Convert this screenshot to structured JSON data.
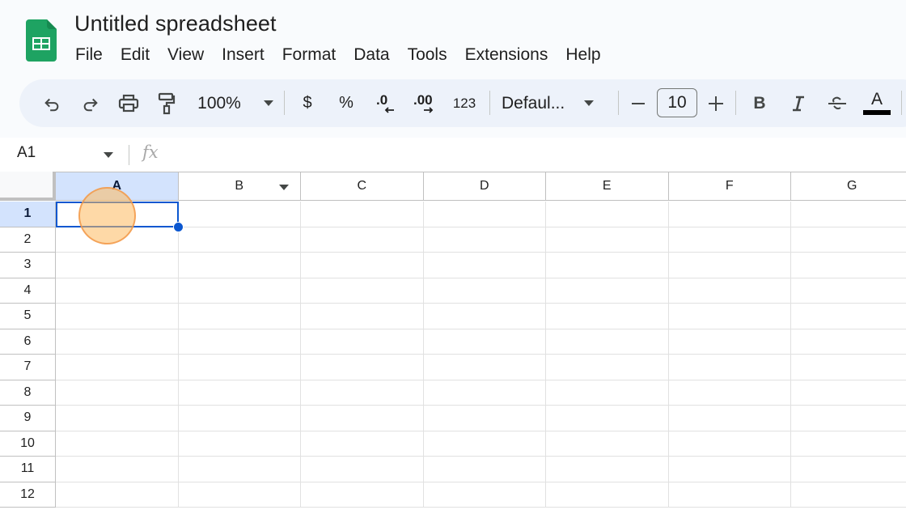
{
  "app": {
    "title": "Untitled spreadsheet",
    "logo": "google-sheets-logo",
    "brand_color": "#1ea362"
  },
  "menu": [
    "File",
    "Edit",
    "View",
    "Insert",
    "Format",
    "Data",
    "Tools",
    "Extensions",
    "Help"
  ],
  "toolbar": {
    "undo": "undo-icon",
    "redo": "redo-icon",
    "print": "print-icon",
    "paint_format": "paint-format-icon",
    "zoom": "100%",
    "currency": "$",
    "percent": "%",
    "decrease_decimal": ".0",
    "increase_decimal": ".00",
    "more_formats": "123",
    "font": "Defaul...",
    "font_size": "10",
    "decrease_size": "−",
    "increase_size": "+",
    "bold": "B",
    "italic": "I",
    "strikethrough": "S",
    "text_color": "A",
    "text_color_value": "#000000"
  },
  "formula_bar": {
    "name_box": "A1",
    "fx": "fx",
    "value": ""
  },
  "grid": {
    "columns": [
      "A",
      "B",
      "C",
      "D",
      "E",
      "F",
      "G"
    ],
    "rows": [
      "1",
      "2",
      "3",
      "4",
      "5",
      "6",
      "7",
      "8",
      "9",
      "10",
      "11",
      "12"
    ],
    "selected_cell": "A1",
    "selection_color": "#0b57d0",
    "header_highlight": "#d3e3fd"
  }
}
